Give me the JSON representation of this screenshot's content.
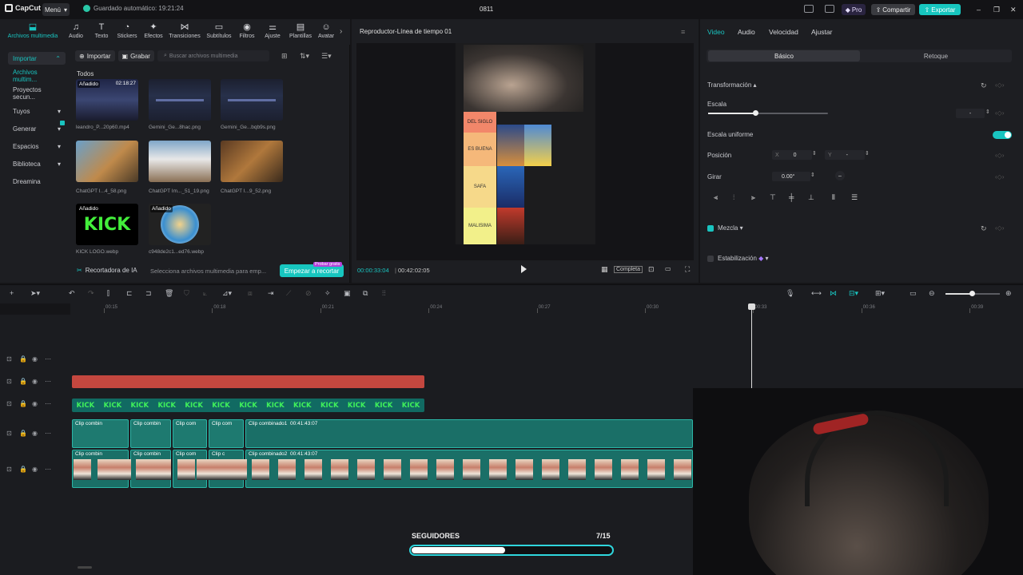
{
  "app": {
    "name": "CapCut",
    "menu": "Menú",
    "autosave": "Guardado automático: 19:21:24",
    "project": "0811",
    "pro": "Pro",
    "share": "Compartir",
    "export": "Exportar"
  },
  "tools": [
    {
      "label": "Archivos multimedia",
      "icon": "import-icon"
    },
    {
      "label": "Audio",
      "icon": "audio-icon"
    },
    {
      "label": "Texto",
      "icon": "text-icon"
    },
    {
      "label": "Stickers",
      "icon": "sticker-icon"
    },
    {
      "label": "Efectos",
      "icon": "effects-icon"
    },
    {
      "label": "Transiciones",
      "icon": "transition-icon"
    },
    {
      "label": "Subtítulos",
      "icon": "subtitle-icon"
    },
    {
      "label": "Filtros",
      "icon": "filter-icon"
    },
    {
      "label": "Ajuste",
      "icon": "adjust-icon"
    },
    {
      "label": "Plantillas",
      "icon": "template-icon"
    },
    {
      "label": "Avatar",
      "icon": "avatar-icon"
    }
  ],
  "sidebar": [
    {
      "label": "Importar"
    },
    {
      "label": "Archivos multim..."
    },
    {
      "label": "Proyectos secun..."
    },
    {
      "label": "Tuyos"
    },
    {
      "label": "Generar"
    },
    {
      "label": "Espacios"
    },
    {
      "label": "Biblioteca"
    },
    {
      "label": "Dreamina"
    }
  ],
  "media": {
    "import": "Importar",
    "record": "Grabar",
    "search_placeholder": "Buscar archivos multimedia",
    "all": "Todos",
    "items": [
      {
        "name": "leandro_P...20p60.mp4",
        "added": "Añadido",
        "duration": "02:18:27"
      },
      {
        "name": "Gemini_Ge...8hac.png",
        "added": "",
        "duration": ""
      },
      {
        "name": "Gemini_Ge...bqb9s.png",
        "added": "",
        "duration": ""
      },
      {
        "name": "ChatGPT I...4_58.png",
        "added": "",
        "duration": ""
      },
      {
        "name": "ChatGPT Im..._51_19.png",
        "added": "",
        "duration": ""
      },
      {
        "name": "ChatGPT I...9_52.png",
        "added": "",
        "duration": ""
      },
      {
        "name": "KICK LOGO.webp",
        "added": "Añadido",
        "duration": ""
      },
      {
        "name": "c948de2c1...ed76.webp",
        "added": "Añadido",
        "duration": ""
      }
    ]
  },
  "ai": {
    "title": "Recortadora de IA",
    "desc": "Selecciona archivos multimedia para emp...",
    "button": "Empezar a recortar",
    "badge": "Probar gratis"
  },
  "player": {
    "title": "Reproductor-Línea de tiempo 01",
    "time": "00:00:33:04",
    "duration": "00:42:02:05",
    "complete": "Completa",
    "tiers": [
      "DEL SIGLO",
      "ES BUENA",
      "SAFA",
      "MALISIMA"
    ]
  },
  "inspector": {
    "tabs": [
      "Video",
      "Audio",
      "Velocidad",
      "Ajustar"
    ],
    "subtabs": [
      "Básico",
      "Retoque"
    ],
    "transform": "Transformación",
    "scale": "Escala",
    "uniform": "Escala uniforme",
    "position": "Posición",
    "x_label": "X",
    "x_value": "0",
    "y_label": "Y",
    "y_value": "-",
    "rotate": "Girar",
    "rotate_value": "0.00°",
    "blend": "Mezcla",
    "stabilize": "Estabilización",
    "scale_value": "-"
  },
  "ruler": [
    "00:15",
    "00:18",
    "00:21",
    "00:24",
    "00:27",
    "00:30",
    "00:33",
    "00:36",
    "00:39"
  ],
  "kick": "KICK",
  "clips": {
    "c1": "Clip combinado1",
    "c2": "Clip combinado2",
    "short1": "Clip combin",
    "short2": "Clip com",
    "short3": "Clip c",
    "tc": "00:41:43:07"
  },
  "followers": {
    "label": "SEGUIDORES",
    "count": "7/15",
    "progress": 0.4667
  }
}
